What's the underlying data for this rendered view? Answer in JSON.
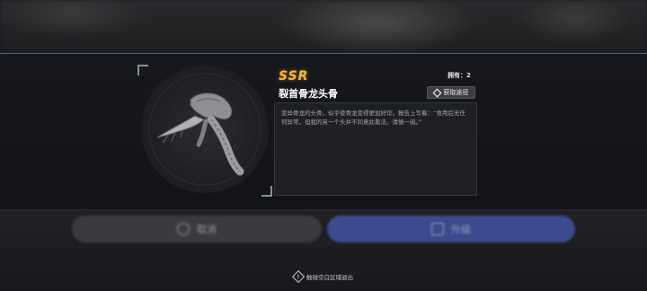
{
  "item": {
    "rarity": "SSR",
    "name": "裂首骨龙头骨",
    "owned_label": "拥有：2",
    "source_button_label": "获取途径",
    "description": "变异骨龙的头骨。似乎使骨龙变得更加好诈。报告上写着：“食用后无任何异常，但我的另一个头并不同意此看法。请慎一阅。”"
  },
  "background_buttons": {
    "left_label": "取消",
    "right_label": "升级"
  },
  "exit_hint": "触碰空白区域退出",
  "colors": {
    "rarity": "#f6b73a",
    "band_border": "#4a5d9a",
    "blurred_primary": "#3c4a8e"
  },
  "icons": {
    "source_button": "diamond-icon",
    "exit_hint": "alert-diamond-icon"
  }
}
